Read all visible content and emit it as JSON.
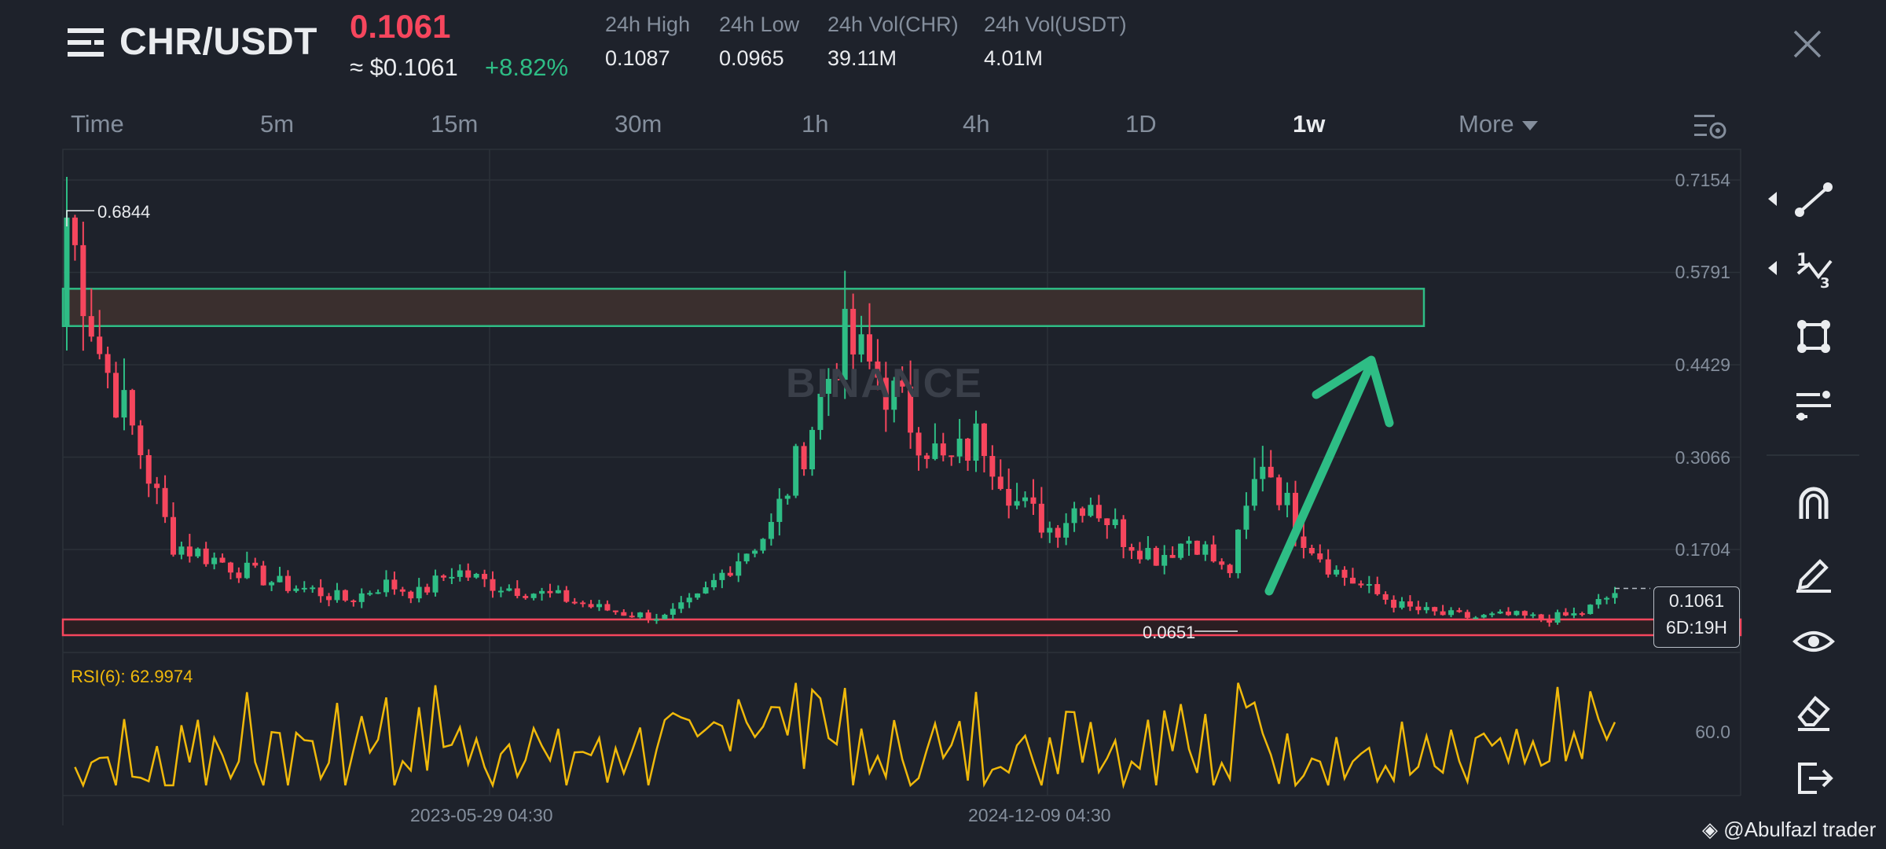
{
  "header": {
    "pair": "CHR/USDT",
    "last_price": "0.1061",
    "usd_approx": "≈ $0.1061",
    "change_pct": "+8.82%",
    "stats": [
      {
        "label": "24h High",
        "value": "0.1087"
      },
      {
        "label": "24h Low",
        "value": "0.0965"
      },
      {
        "label": "24h Vol(CHR)",
        "value": "39.11M"
      },
      {
        "label": "24h Vol(USDT)",
        "value": "4.01M"
      }
    ]
  },
  "timeframes": {
    "items": [
      "Time",
      "5m",
      "15m",
      "30m",
      "1h",
      "4h",
      "1D",
      "1w"
    ],
    "active": "1w",
    "more_label": "More"
  },
  "chart": {
    "watermark": "BINANCE",
    "y_ticks": [
      "0.7154",
      "0.5791",
      "0.4429",
      "0.3066",
      "0.1704"
    ],
    "x_ticks": [
      "2023-05-29 04:30",
      "2024-12-09 04:30"
    ],
    "period_high": "0.6844",
    "period_low": "0.0651",
    "current_price": "0.1061",
    "countdown": "6D:19H",
    "rsi_label": "RSI(6): 62.9974",
    "rsi_tick": "60.0",
    "colors": {
      "up": "#2ebd85",
      "down": "#f6465d",
      "rsi": "#f0b90b",
      "zone_resistance": "#2ebd85",
      "zone_support": "#f6465d",
      "arrow": "#2ebd85"
    }
  },
  "chart_data": {
    "type": "candlestick",
    "interval": "1w",
    "y_ticks": [
      0.7154,
      0.5791,
      0.4429,
      0.3066,
      0.1704
    ],
    "resistance_zone": [
      0.5,
      0.555
    ],
    "support_zone": [
      0.06,
      0.08
    ],
    "current_price": 0.1061,
    "high": 0.6844,
    "low": 0.0651,
    "rsi_period": 6,
    "rsi_current": 62.9974,
    "close_path": [
      0.66,
      0.45,
      0.33,
      0.18,
      0.16,
      0.14,
      0.12,
      0.11,
      0.095,
      0.12,
      0.105,
      0.14,
      0.12,
      0.11,
      0.1,
      0.085,
      0.075,
      0.07,
      0.1,
      0.155,
      0.2,
      0.33,
      0.48,
      0.43,
      0.36,
      0.29,
      0.34,
      0.24,
      0.2,
      0.25,
      0.19,
      0.16,
      0.19,
      0.13,
      0.31,
      0.2,
      0.14,
      0.11,
      0.085,
      0.075,
      0.07,
      0.073,
      0.068,
      0.075,
      0.1061
    ]
  },
  "toolbar": {
    "tools": [
      "trend-line-icon",
      "fibonacci-icon",
      "shape-icon",
      "indicator-list-icon",
      "magnet-icon",
      "pencil-icon",
      "eye-icon",
      "eraser-icon",
      "exit-icon"
    ]
  },
  "credit": "@Abulfazl trader"
}
